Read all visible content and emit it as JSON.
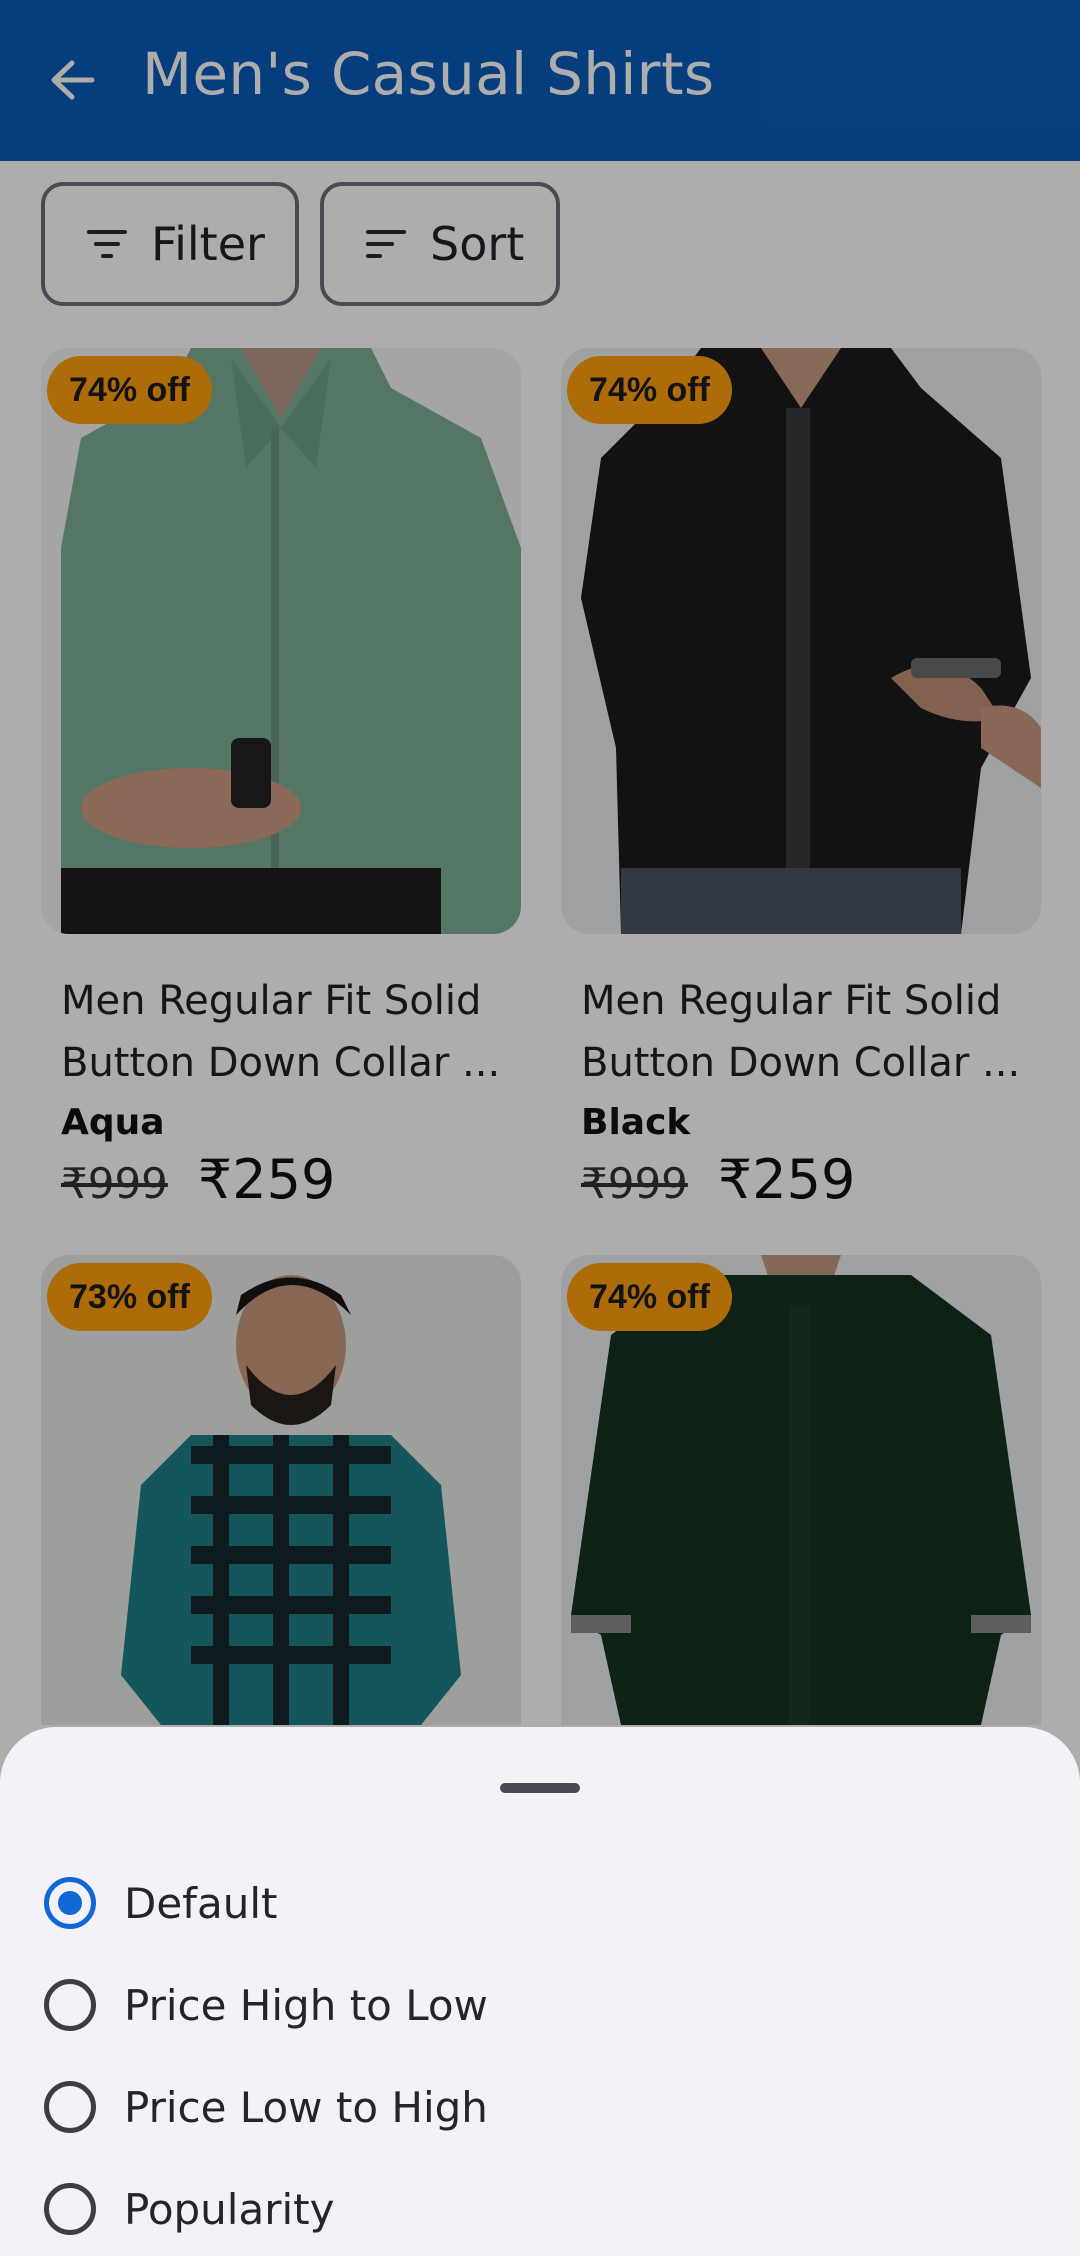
{
  "header": {
    "title": "Men's Casual Shirts",
    "back_icon": "arrow-left-icon"
  },
  "toolbar": {
    "filter_label": "Filter",
    "sort_label": "Sort"
  },
  "products": [
    {
      "badge": "74% off",
      "name": "Men Regular Fit Solid Button Down Collar ...",
      "color": "Aqua",
      "mrp": "₹999",
      "price": "₹259",
      "shirt_color": "#7fae96"
    },
    {
      "badge": "74% off",
      "name": "Men Regular Fit Solid Button Down Collar ...",
      "color": "Black",
      "mrp": "₹999",
      "price": "₹259",
      "shirt_color": "#1b1b1d"
    },
    {
      "badge": "73% off",
      "shirt_color": "#1f7f8a"
    },
    {
      "badge": "74% off",
      "shirt_color": "#16331f"
    }
  ],
  "sort_sheet": {
    "options": [
      {
        "label": "Default",
        "selected": true
      },
      {
        "label": "Price High to Low",
        "selected": false
      },
      {
        "label": "Price Low to High",
        "selected": false
      },
      {
        "label": "Popularity",
        "selected": false
      }
    ]
  },
  "colors": {
    "primary": "#0a5bb8",
    "badge": "#ff9f0d",
    "radio_selected": "#1167d6"
  }
}
